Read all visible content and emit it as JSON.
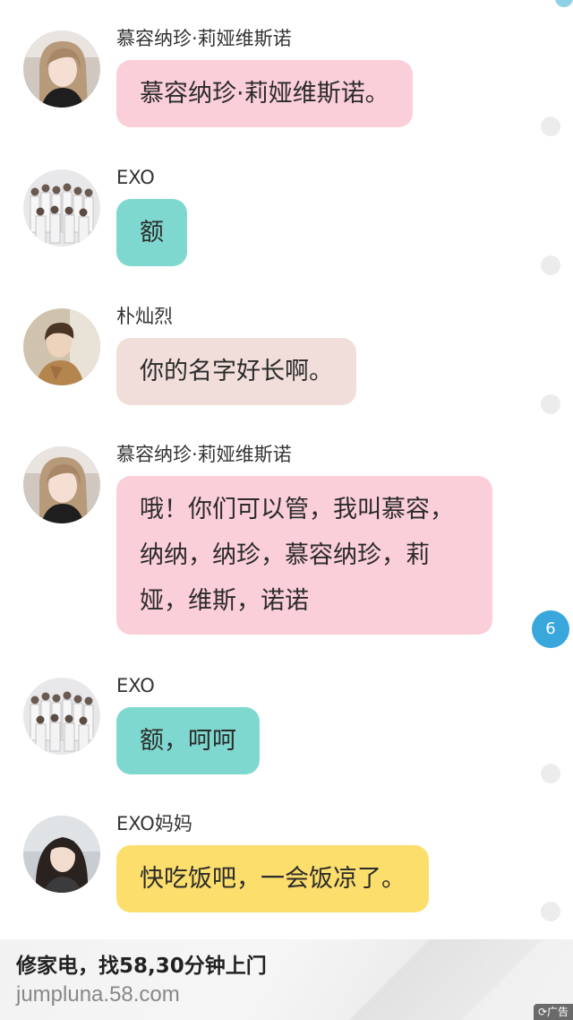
{
  "colors": {
    "pink_bubble": "#fbcfd9",
    "teal_bubble": "#7fd8cf",
    "beige_bubble": "#f1dedb",
    "yellow_bubble": "#fcde6c",
    "badge_blue": "#39a7dc",
    "read_dot": "#ececec"
  },
  "messages": [
    {
      "sender": "慕容纳珍·莉娅维斯诺",
      "text": "慕容纳珍·莉娅维斯诺。",
      "avatar": "girl-avatar",
      "bubble": "pink"
    },
    {
      "sender": "EXO",
      "text": "额",
      "avatar": "group-avatar",
      "bubble": "teal"
    },
    {
      "sender": "朴灿烈",
      "text": "你的名字好长啊。",
      "avatar": "boy-avatar",
      "bubble": "beige"
    },
    {
      "sender": "慕容纳珍·莉娅维斯诺",
      "text": "哦！你们可以管，我叫慕容，纳纳，纳珍，慕容纳珍，莉娅，维斯，诺诺",
      "avatar": "girl-avatar",
      "bubble": "pink"
    },
    {
      "sender": "EXO",
      "text": "额，呵呵",
      "avatar": "group-avatar",
      "bubble": "teal"
    },
    {
      "sender": "EXO妈妈",
      "text": "快吃饭吧，一会饭凉了。",
      "avatar": "woman-avatar",
      "bubble": "yellow"
    }
  ],
  "unread_badge": "6",
  "ad": {
    "title": "修家电，找58,30分钟上门",
    "url": "jumpluna.58.com",
    "tag": "⟳广告"
  }
}
